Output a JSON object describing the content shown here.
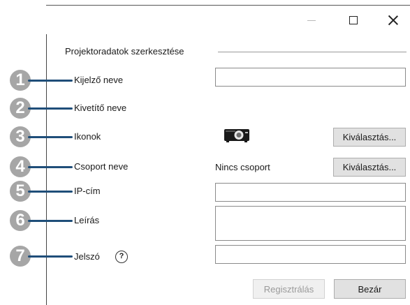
{
  "window_controls": {
    "minimize": "minimize",
    "maximize": "maximize",
    "close": "close"
  },
  "group": {
    "title": "Projektoradatok szerkesztése"
  },
  "fields": [
    {
      "number": "1",
      "label": "Kijelző neve",
      "value": ""
    },
    {
      "number": "2",
      "label": "Kivetítő neve"
    },
    {
      "number": "3",
      "label": "Ikonok",
      "icon": "projector-icon",
      "button": "Kiválasztás..."
    },
    {
      "number": "4",
      "label": "Csoport neve",
      "value": "Nincs csoport",
      "button": "Kiválasztás..."
    },
    {
      "number": "5",
      "label": "IP-cím",
      "value": ""
    },
    {
      "number": "6",
      "label": "Leírás",
      "value": ""
    },
    {
      "number": "7",
      "label": "Jelszó",
      "help": "?",
      "value": ""
    }
  ],
  "footer": {
    "register": "Regisztrálás",
    "close": "Bezár"
  }
}
